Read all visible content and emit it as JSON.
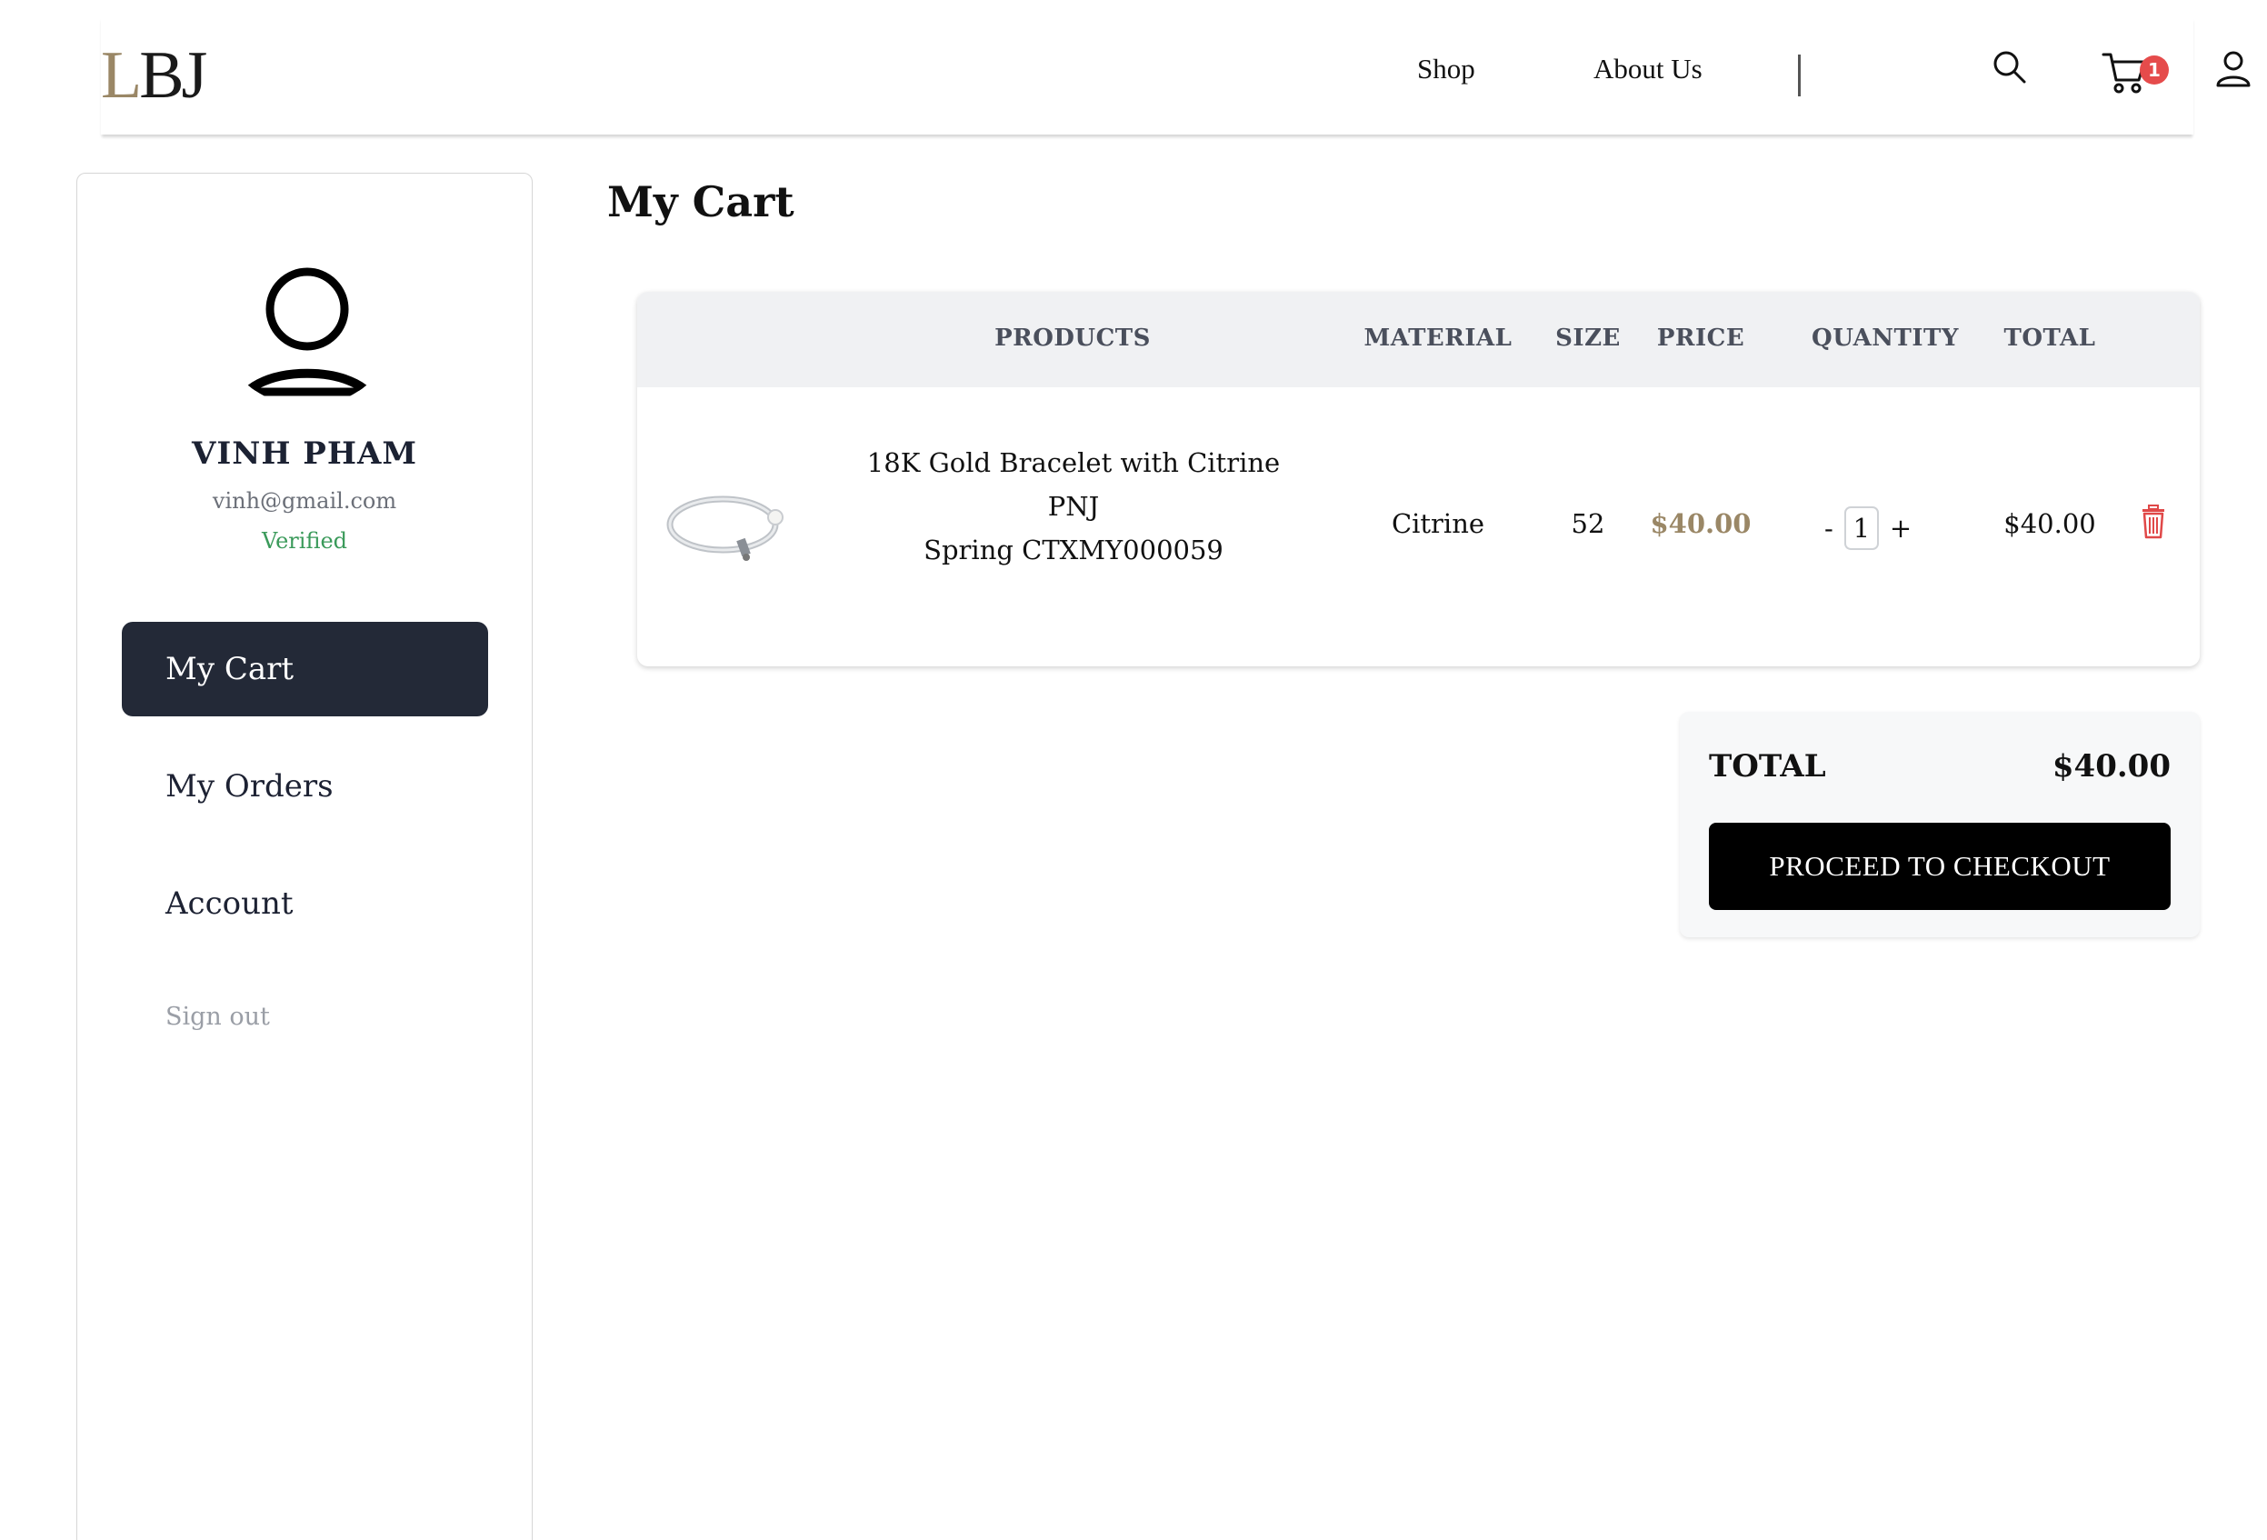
{
  "header": {
    "logo_part1": "L",
    "logo_part2": "BJ",
    "nav": {
      "shop": "Shop",
      "about": "About Us"
    },
    "cart_count": "1",
    "icons": [
      "search-icon",
      "cart-icon",
      "user-icon"
    ]
  },
  "sidebar": {
    "user": {
      "name": "VINH PHAM",
      "email": "vinh@gmail.com",
      "status": "Verified"
    },
    "menu": [
      {
        "label": "My Cart",
        "active": true
      },
      {
        "label": "My Orders",
        "active": false
      },
      {
        "label": "Account",
        "active": false
      }
    ],
    "signout": "Sign out"
  },
  "main": {
    "title": "My Cart",
    "table": {
      "headers": [
        "PRODUCTS",
        "MATERIAL",
        "SIZE",
        "PRICE",
        "QUANTITY",
        "TOTAL"
      ],
      "rows": [
        {
          "product_line1": "18K Gold Bracelet with Citrine PNJ",
          "product_line2": "Spring CTXMY000059",
          "material": "Citrine",
          "size": "52",
          "price": "$40.00",
          "qty_minus": "-",
          "quantity": "1",
          "qty_plus": "+",
          "total": "$40.00"
        }
      ]
    },
    "summary": {
      "total_label": "TOTAL",
      "total_value": "$40.00",
      "checkout_label": "PROCEED TO CHECKOUT"
    }
  },
  "colors": {
    "accent_gold": "#9a8766",
    "sidebar_active": "#232937",
    "verified_green": "#3a9a5a",
    "badge_red": "#e54b4b",
    "trash_red": "#e04848"
  }
}
